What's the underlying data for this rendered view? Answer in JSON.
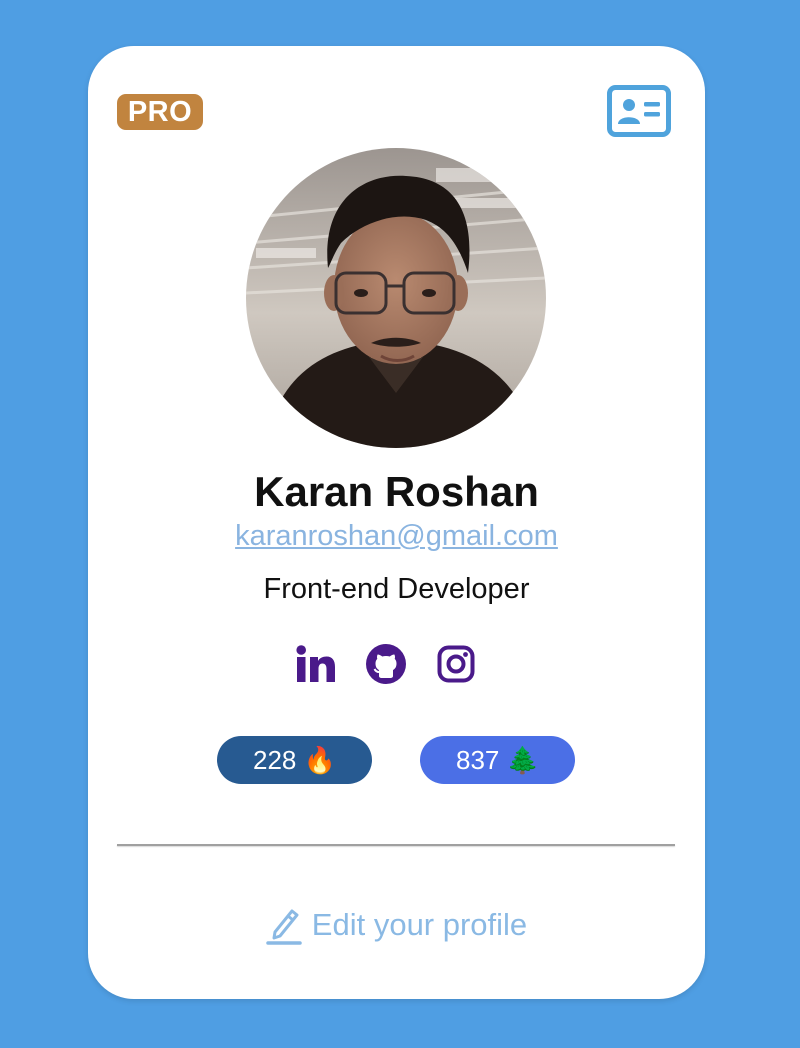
{
  "badge": {
    "label": "PRO",
    "color": "#c1843f"
  },
  "header": {
    "card_icon": "id-card-icon"
  },
  "profile": {
    "name": "Karan Roshan",
    "email": "karanroshan@gmail.com",
    "role": "Front-end Developer",
    "avatar": "profile-photo"
  },
  "socials": [
    {
      "icon": "linkedin-icon"
    },
    {
      "icon": "github-icon"
    },
    {
      "icon": "instagram-icon"
    }
  ],
  "stats": {
    "streak": {
      "value": "228",
      "emoji": "🔥",
      "color": "#275a91"
    },
    "trees": {
      "value": "837",
      "emoji": "🌲",
      "color": "#4b6fe6"
    }
  },
  "footer": {
    "edit_label": "Edit your profile",
    "icon": "pencil-icon"
  },
  "colors": {
    "background": "#4f9ee3",
    "card": "#ffffff",
    "link": "#8ab4e0",
    "social": "#4a1a8a"
  }
}
